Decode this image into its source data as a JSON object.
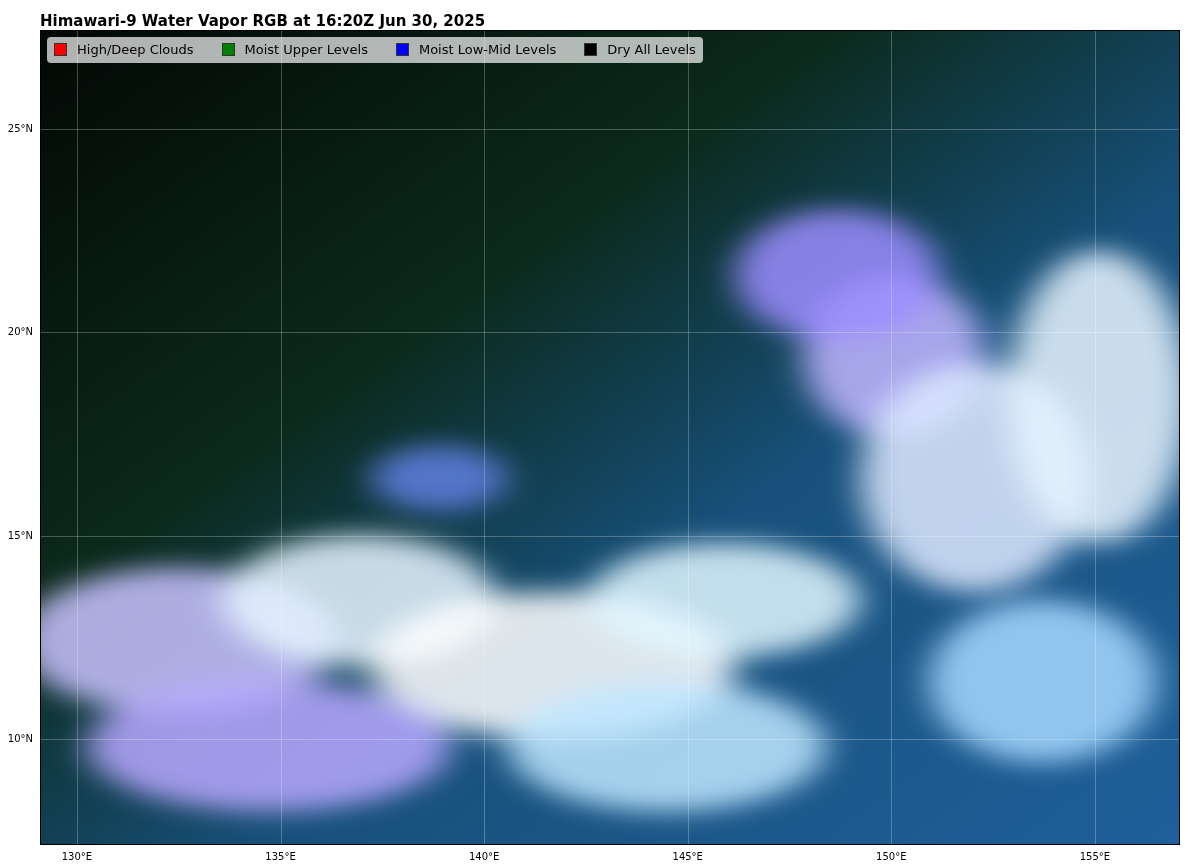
{
  "title": "Himawari-9 Water Vapor RGB at 16:20Z Jun 30, 2025",
  "legend": [
    {
      "label": "High/Deep Clouds",
      "color": "#ff0000"
    },
    {
      "label": "Moist Upper Levels",
      "color": "#008000"
    },
    {
      "label": "Moist Low-Mid Levels",
      "color": "#0000ff"
    },
    {
      "label": "Dry All Levels",
      "color": "#000000"
    }
  ],
  "y_ticks": [
    "25°N",
    "20°N",
    "15°N",
    "10°N"
  ],
  "x_ticks": [
    "130°E",
    "135°E",
    "140°E",
    "145°E",
    "150°E",
    "155°E"
  ]
}
